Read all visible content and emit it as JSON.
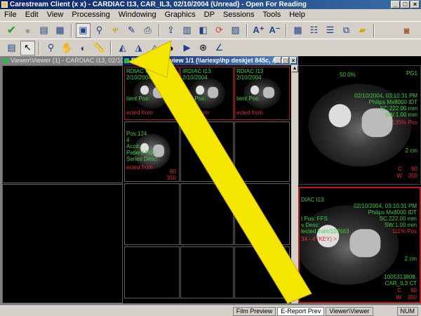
{
  "window": {
    "title": "Carestream Client (x x) - CARDIAC I13, CAR_IL3, 02/10/2004 (Unread) - Open For Reading"
  },
  "menu": [
    "File",
    "Edit",
    "View",
    "Processing",
    "Windowing",
    "Graphics",
    "DP",
    "Sessions",
    "Tools",
    "Help"
  ],
  "toolbar1": [
    "check-icon",
    "circle-icon",
    "open-icon",
    "table-icon",
    "report-icon",
    "search-icon",
    "key-icon",
    "note-icon",
    "print-icon",
    "export-icon",
    "compare-icon",
    "window-icon",
    "sync-icon",
    "layout-icon",
    "font-up-icon",
    "font-down-icon",
    "grid-icon",
    "series-icon",
    "study-icon",
    "compare2-icon",
    "notes-icon",
    "exit-icon"
  ],
  "toolbar2": [
    "layout-icon",
    "pointer-icon",
    "zoom-icon",
    "pan-icon",
    "window-level-icon",
    "ruler-icon",
    "flip-horizontal-icon",
    "flip-vertical-icon",
    "rotate-icon",
    "invert-icon",
    "cine-icon",
    "reset-icon",
    "angle-icon"
  ],
  "viewer": {
    "title": "Viewer\\Viewer (1) - CARDIAC I13, 02/10/2004"
  },
  "ereport": {
    "title": "E-Report Preview 1/1 (\\\\ariexp\\hp deskjet 845c, A4)",
    "top_cells": [
      {
        "line1": "RDIAC I13",
        "line2": "2/10/2004",
        "extra": "tient Pos:",
        "red": "ected from"
      },
      {
        "line1": "IRDIAC I13",
        "line2": "2/10/2004",
        "extra": "tient Pos:",
        "red": "ected from"
      },
      {
        "line1": "RDIAC I13",
        "line2": "2/10/2004",
        "extra": "tient Pos:",
        "red": "ected from"
      }
    ],
    "mid_cell": {
      "lines": [
        "Pos:124",
        "4",
        "Acc#:",
        "Patient Pos:",
        "Series Desc:"
      ],
      "red": "ected from",
      "values": [
        "60",
        "350"
      ]
    }
  },
  "right_top": {
    "zoom": "50.0%",
    "pg": "PG1",
    "date": "02/10/2004, 03:10:31 PM",
    "scanner": "Philips Mx8000 IDT",
    "sc": "SC:222.00 mm",
    "sw": "SW:1.00 mm",
    "pos": "135% Pos",
    "cm": "2 cm",
    "c": "C",
    "c_val": "60",
    "w": "W",
    "w_val": "350"
  },
  "right_bottom": {
    "name": "DIAC I13",
    "date": "02/10/2004, 03:10:31 PM",
    "scanner": "Philips Mx8000 IDT",
    "pos": "t Pos: FFS",
    "sc": "SC:222.00 mm",
    "series": "s Desc:",
    "sw": "SW:1.00 mm",
    "selected": "lected from/107663",
    "pos_pct": "111% Pos",
    "key": "34 - 4 (KEY) >",
    "cm": "2 cm",
    "uid1": "1005313808.",
    "uid2": "CAR_IL3 CT",
    "c": "C",
    "c_val": "60",
    "w": "W",
    "w_val": "350"
  },
  "status_tabs": [
    "Film Preview",
    "E-Report Prev",
    "Viewer\\Viewer"
  ],
  "status_right": "NUM",
  "colors": {
    "titlebar": "#0a246a",
    "chrome": "#d4d0c8",
    "overlay_green": "#3cd13c",
    "overlay_red": "#e03030",
    "arrow": "#f5e600"
  }
}
